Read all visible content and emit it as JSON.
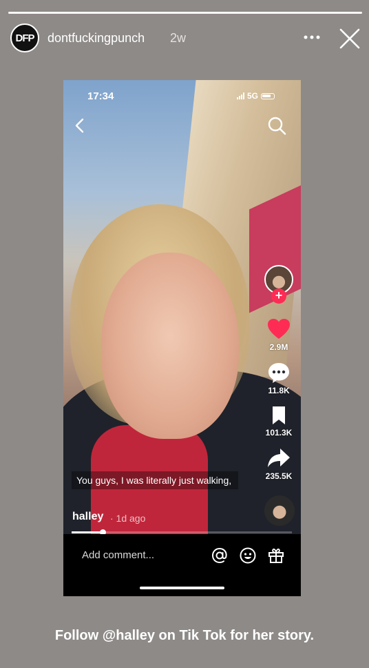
{
  "story": {
    "username": "dontfuckingpunch",
    "time_ago": "2w",
    "avatar_text": "DFP",
    "footer_text": "Follow @halley on Tik Tok for her story."
  },
  "tiktok": {
    "status_time": "17:34",
    "network": "5G",
    "likes": "2.9M",
    "comments": "11.8K",
    "saves": "101.3K",
    "shares": "235.5K",
    "caption": "You guys, I was literally just walking,",
    "author": "halley",
    "posted": "· 1d ago",
    "comment_placeholder": "Add comment...",
    "playback_progress": 0.14,
    "colors": {
      "like": "#fe2c55",
      "follow": "#fe2c55"
    }
  },
  "icons": [
    "more-icon",
    "close-icon",
    "back-icon",
    "search-icon",
    "heart-icon",
    "comment-icon",
    "bookmark-icon",
    "share-icon",
    "mention-icon",
    "emoji-icon",
    "gift-icon"
  ]
}
